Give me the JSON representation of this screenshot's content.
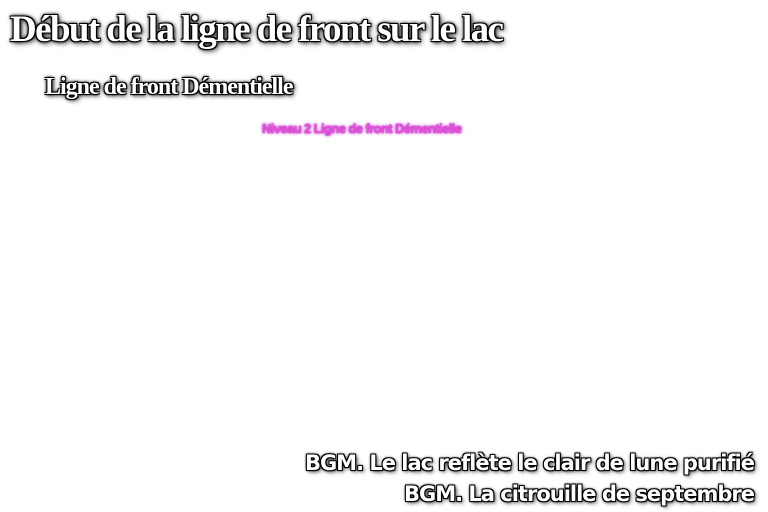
{
  "stage": {
    "title": "Début de la ligne de front sur le lac",
    "subtitle": "Ligne de front Démentielle",
    "level_caption": "Niveau 2  Ligne de front Démentielle"
  },
  "bgm": {
    "lines": [
      "BGM. Le lac reflète le clair de lune purifié",
      "BGM. La citrouille de septembre"
    ]
  },
  "colors": {
    "background": "#ffffff",
    "title_text": "#ffffff",
    "title_outline": "#000000",
    "level_caption": "#f050e0",
    "bgm_text": "#ffffff"
  }
}
